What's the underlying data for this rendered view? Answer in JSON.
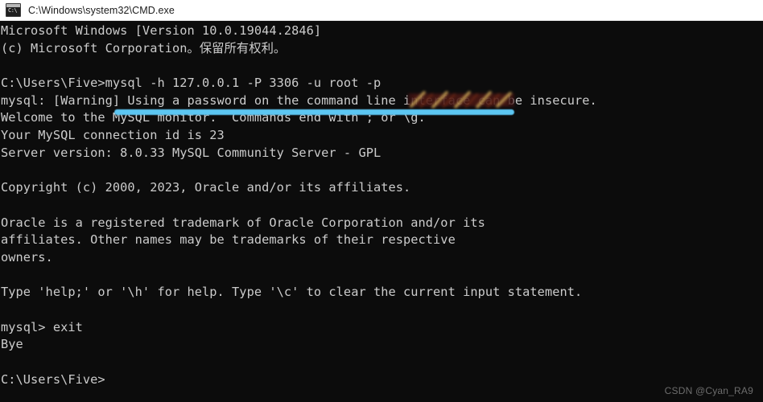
{
  "window": {
    "title": "C:\\Windows\\system32\\CMD.exe",
    "icon_name": "cmd-console-icon",
    "icon_glyph": "C:\\",
    "background_color": "#0c0c0c",
    "text_color": "#cccccc",
    "titlebar_color": "#ffffff"
  },
  "terminal": {
    "lines": [
      "Microsoft Windows [Version 10.0.19044.2846]",
      "(c) Microsoft Corporation。保留所有权利。",
      "",
      "C:\\Users\\Five>mysql -h 127.0.0.1 -P 3306 -u root -p",
      "mysql: [Warning] Using a password on the command line interface can be insecure.",
      "Welcome to the MySQL monitor.  Commands end with ; or \\g.",
      "Your MySQL connection id is 23",
      "Server version: 8.0.33 MySQL Community Server - GPL",
      "",
      "Copyright (c) 2000, 2023, Oracle and/or its affiliates.",
      "",
      "Oracle is a registered trademark of Oracle Corporation and/or its",
      "affiliates. Other names may be trademarks of their respective",
      "owners.",
      "",
      "Type 'help;' or '\\h' for help. Type '\\c' to clear the current input statement.",
      "",
      "mysql> exit",
      "Bye",
      "",
      "C:\\Users\\Five>"
    ]
  },
  "annotations": {
    "redaction": {
      "name": "password-redaction-scribble",
      "stroke_color": "#c8a055",
      "fill_color": "#3a1010"
    },
    "underline": {
      "name": "command-underline",
      "color": "#5cc6f2"
    }
  },
  "watermark": {
    "text": "CSDN @Cyan_RA9",
    "color": "#6d6d6d"
  }
}
